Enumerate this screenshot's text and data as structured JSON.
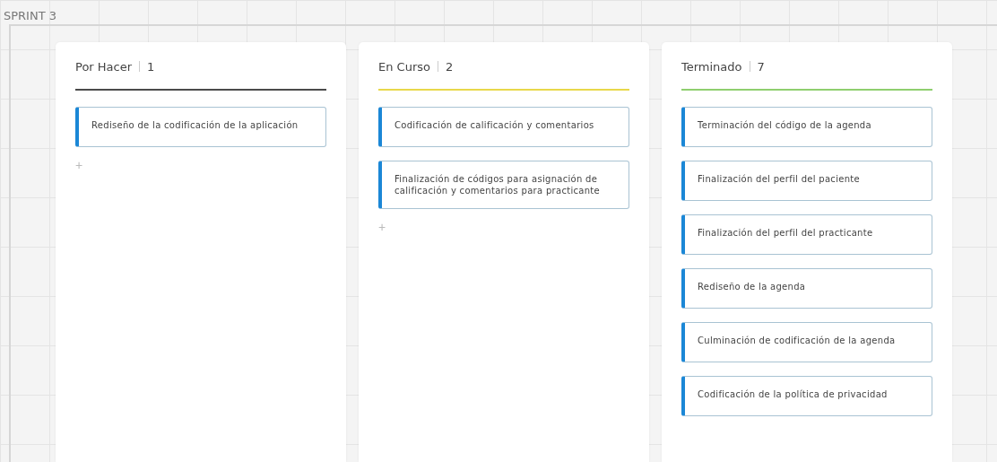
{
  "board": {
    "title": "SPRINT 3"
  },
  "columns": [
    {
      "name": "Por Hacer",
      "count": "1",
      "color": "#4a4a4a",
      "cards": [
        "Rediseño de la codificación de la aplicación"
      ],
      "add_label": "+"
    },
    {
      "name": "En Curso",
      "count": "2",
      "color": "#e8d84a",
      "cards": [
        "Codificación de calificación y comentarios",
        "Finalización de códigos para asignación de calificación y comentarios para practicante"
      ],
      "add_label": "+"
    },
    {
      "name": "Terminado",
      "count": "7",
      "color": "#8fcf6f",
      "cards": [
        "Terminación del código de la agenda",
        "Finalización del perfil del paciente",
        "Finalización del perfil del practicante",
        "Rediseño de la agenda",
        "Culminación de codificación de la agenda",
        "Codificación de la política de privacidad"
      ]
    }
  ]
}
